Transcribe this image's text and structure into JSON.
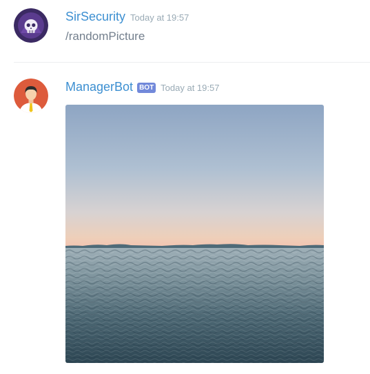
{
  "messages": [
    {
      "author": "SirSecurity",
      "timestamp": "Today at 19:57",
      "text": "/randomPicture",
      "avatar_icon": "skull-hooded-avatar-icon"
    },
    {
      "author": "ManagerBot",
      "badge": "BOT",
      "timestamp": "Today at 19:57",
      "avatar_icon": "businessman-avatar-icon",
      "attachment": {
        "type": "image",
        "subject": "calm sea under a pastel sunset sky"
      }
    }
  ],
  "colors": {
    "username": "#3c8fd1",
    "timestamp": "#99aab5",
    "message_text": "#737f8d",
    "bot_badge": "#7289da"
  }
}
